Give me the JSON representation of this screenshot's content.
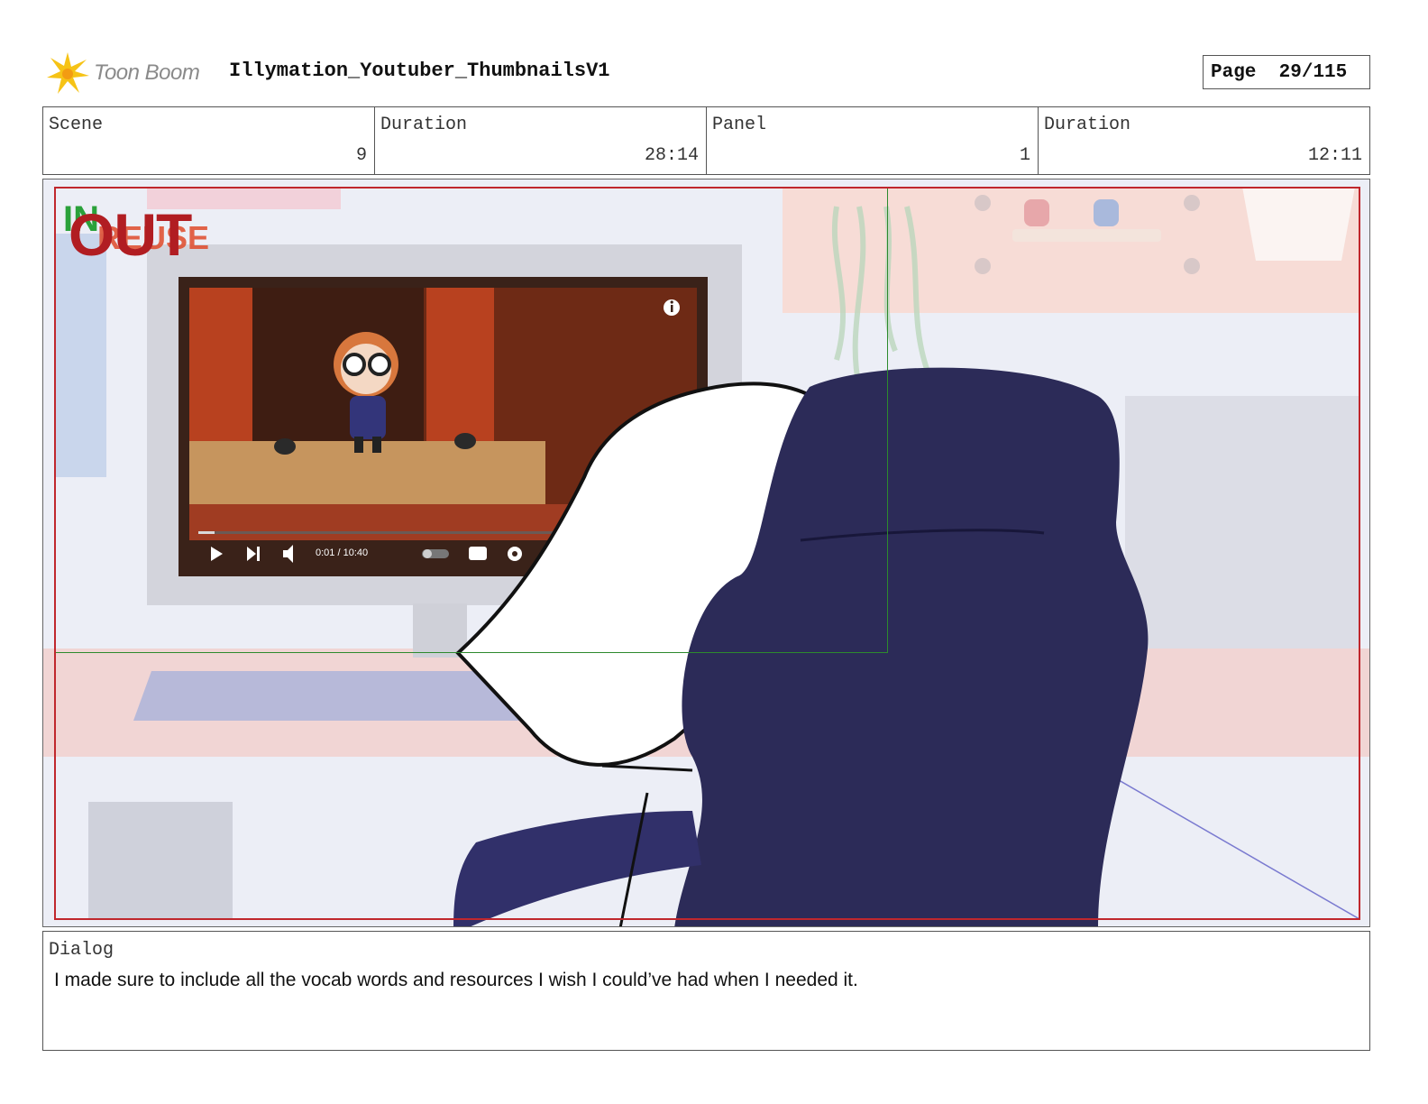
{
  "header": {
    "logo_text": "Toon Boom",
    "title": "Illymation_Youtuber_ThumbnailsV1",
    "page_label": "Page",
    "page_value": "29/115"
  },
  "info": {
    "scene_label": "Scene",
    "scene_value": "9",
    "scene_duration_label": "Duration",
    "scene_duration_value": "28:14",
    "panel_label": "Panel",
    "panel_value": "1",
    "panel_duration_label": "Duration",
    "panel_duration_value": "12:11"
  },
  "panel": {
    "in_label": "IN",
    "out_label": "OUT",
    "reuse_label": "REUSE",
    "video_time": "0:01 / 10:40"
  },
  "dialog": {
    "label": "Dialog",
    "text": "I made sure to include all the vocab words and resources I wish I could’ve had when I needed it."
  },
  "colors": {
    "frame_red": "#c0272d",
    "frame_green": "#2d8a2d",
    "chair_navy": "#2c2b58"
  }
}
